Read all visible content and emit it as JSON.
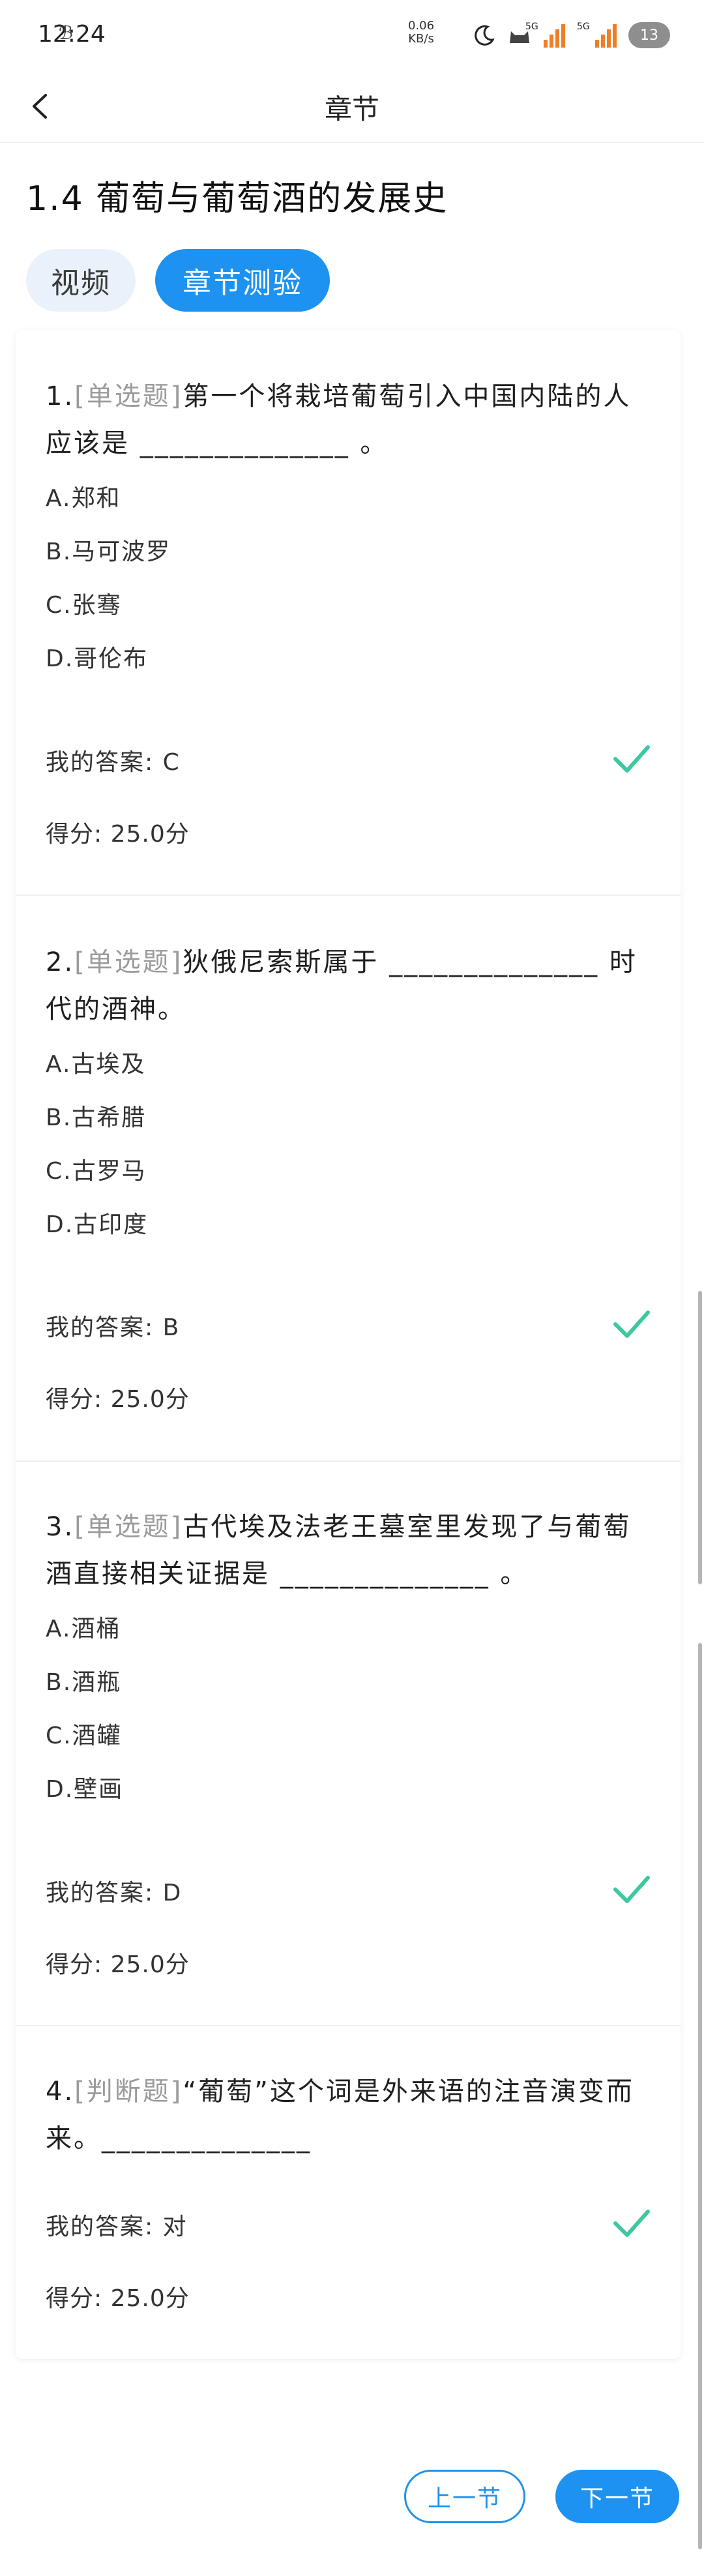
{
  "status_bar": {
    "time": "12:24",
    "small_icon": "ℬ",
    "speed_value": "0.06",
    "speed_unit": "KB/s",
    "signal1_label": "5G",
    "signal2_label": "5G",
    "battery": "13"
  },
  "nav": {
    "title": "章节"
  },
  "page": {
    "title": "1.4 葡萄与葡萄酒的发展史"
  },
  "tabs": [
    {
      "label": "视频",
      "active": false
    },
    {
      "label": "章节测验",
      "active": true
    }
  ],
  "questions": [
    {
      "number": "1.",
      "type": "[单选题]",
      "text": "第一个将栽培葡萄引入中国内陆的人应该是 ______________ 。",
      "options": [
        "A.郑和",
        "B.马可波罗",
        "C.张骞",
        "D.哥伦布"
      ],
      "answer": "我的答案: C",
      "score": "得分: 25.0分"
    },
    {
      "number": "2.",
      "type": "[单选题]",
      "text": "狄俄尼索斯属于 ______________ 时代的酒神。",
      "options": [
        "A.古埃及",
        "B.古希腊",
        "C.古罗马",
        "D.古印度"
      ],
      "answer": "我的答案: B",
      "score": "得分: 25.0分"
    },
    {
      "number": "3.",
      "type": "[单选题]",
      "text": "古代埃及法老王墓室里发现了与葡萄酒直接相关证据是 ______________ 。",
      "options": [
        "A.酒桶",
        "B.酒瓶",
        "C.酒罐",
        "D.壁画"
      ],
      "answer": "我的答案: D",
      "score": "得分: 25.0分"
    },
    {
      "number": "4.",
      "type": "[判断题]",
      "text": "“葡萄”这个词是外来语的注音演变而来。______________",
      "options": [],
      "answer": "我的答案: 对",
      "score": "得分: 25.0分"
    }
  ],
  "footer": {
    "prev_label": "上一节",
    "next_label": "下一节"
  },
  "colors": {
    "accent": "#1d92f0",
    "check": "#3cc8a0",
    "muted": "#9b9b9b"
  }
}
